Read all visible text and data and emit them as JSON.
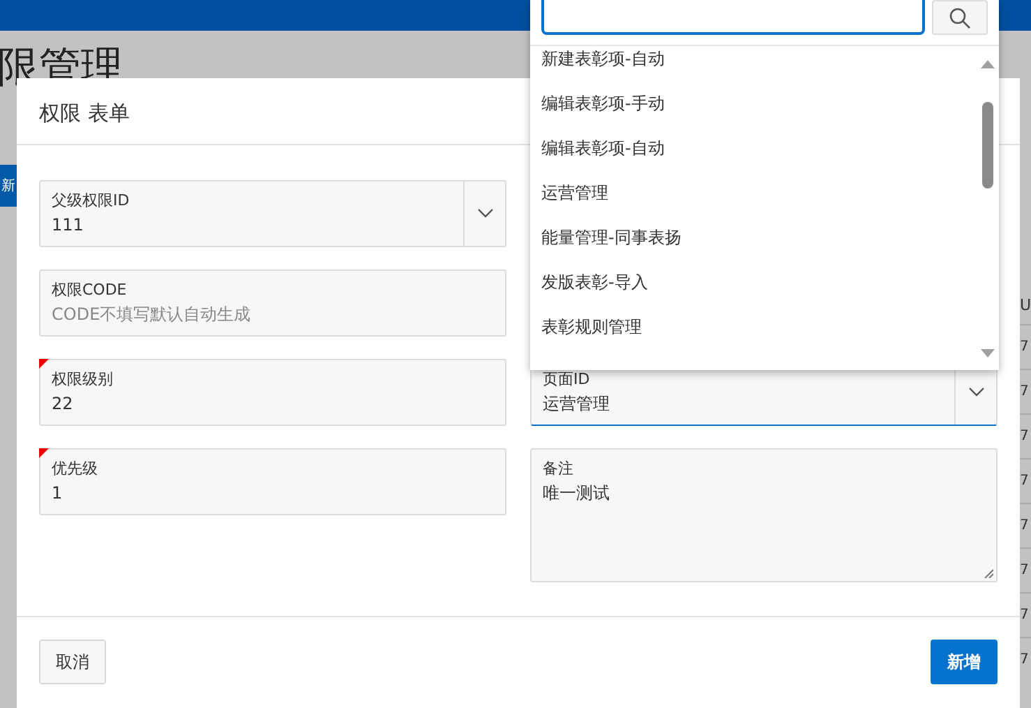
{
  "page": {
    "title": "限管理",
    "new_button": "新",
    "table": {
      "column_1": "U",
      "cells": [
        "7",
        "7",
        "7",
        "7",
        "7",
        "7",
        "7",
        "7"
      ]
    }
  },
  "modal": {
    "title": "权限 表单",
    "left_fields": [
      {
        "label": "父级权限ID",
        "value": "111",
        "kind": "select",
        "required": false,
        "focused": false
      },
      {
        "label": "权限CODE",
        "placeholder": "CODE不填写默认自动生成",
        "kind": "text",
        "required": false,
        "focused": false
      },
      {
        "label": "权限级别",
        "value": "22",
        "kind": "text",
        "required": true,
        "focused": false
      },
      {
        "label": "优先级",
        "value": "1",
        "kind": "text",
        "required": true,
        "focused": false
      }
    ],
    "right_fields": [
      {
        "label": "页面ID",
        "value": "运营管理",
        "kind": "select",
        "required": false,
        "focused": true
      },
      {
        "label": "备注",
        "value": "唯一测试",
        "kind": "textarea",
        "required": false,
        "focused": false
      }
    ],
    "cancel_button": "取消",
    "submit_button": "新增"
  },
  "dropdown": {
    "options": [
      {
        "label": "新建表彰项-自动",
        "selected": false
      },
      {
        "label": "编辑表彰项-手动",
        "selected": false
      },
      {
        "label": "编辑表彰项-自动",
        "selected": false
      },
      {
        "label": "运营管理",
        "selected": false
      },
      {
        "label": "能量管理-同事表扬",
        "selected": false
      },
      {
        "label": "发版表彰-导入",
        "selected": false
      },
      {
        "label": "表彰规则管理",
        "selected": false
      }
    ]
  }
}
